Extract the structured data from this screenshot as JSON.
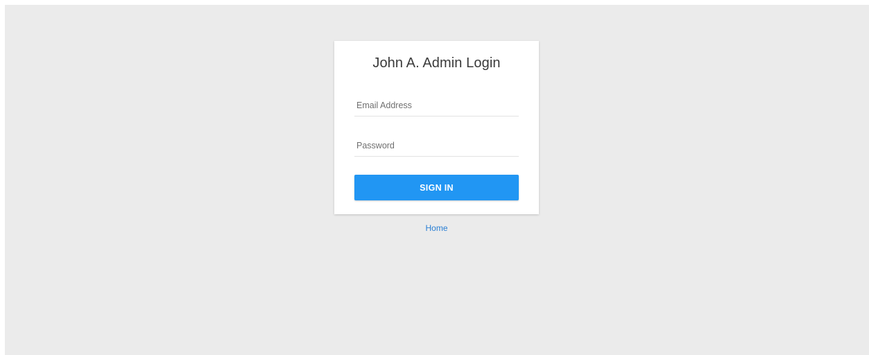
{
  "login": {
    "title": "John A. Admin Login",
    "email": {
      "value": "",
      "placeholder": "Email Address"
    },
    "password": {
      "value": "",
      "placeholder": "Password"
    },
    "submit_label": "SIGN IN"
  },
  "footer": {
    "home_link": "Home"
  },
  "colors": {
    "background": "#ebebeb",
    "card": "#ffffff",
    "primary": "#2196f3",
    "link": "#2a7fd4"
  }
}
